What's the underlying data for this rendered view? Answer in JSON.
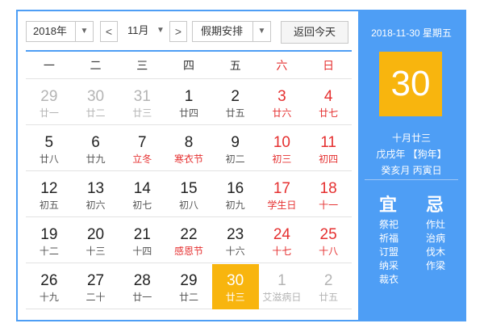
{
  "toolbar": {
    "year_select": "2018年",
    "prev_month": "<",
    "month_select": "11月",
    "next_month": ">",
    "holiday_select": "假期安排",
    "today_button": "返回今天"
  },
  "weekdays": [
    "一",
    "二",
    "三",
    "四",
    "五",
    "六",
    "日"
  ],
  "weeks": [
    [
      {
        "day": "29",
        "lunar": "廿一",
        "other": true
      },
      {
        "day": "30",
        "lunar": "廿二",
        "other": true
      },
      {
        "day": "31",
        "lunar": "廿三",
        "other": true
      },
      {
        "day": "1",
        "lunar": "廿四"
      },
      {
        "day": "2",
        "lunar": "廿五"
      },
      {
        "day": "3",
        "lunar": "廿六",
        "weekend": true
      },
      {
        "day": "4",
        "lunar": "廿七",
        "weekend": true
      }
    ],
    [
      {
        "day": "5",
        "lunar": "廿八"
      },
      {
        "day": "6",
        "lunar": "廿九"
      },
      {
        "day": "7",
        "lunar": "立冬",
        "festival": true
      },
      {
        "day": "8",
        "lunar": "寒衣节",
        "festival": true
      },
      {
        "day": "9",
        "lunar": "初二"
      },
      {
        "day": "10",
        "lunar": "初三",
        "weekend": true
      },
      {
        "day": "11",
        "lunar": "初四",
        "weekend": true
      }
    ],
    [
      {
        "day": "12",
        "lunar": "初五"
      },
      {
        "day": "13",
        "lunar": "初六"
      },
      {
        "day": "14",
        "lunar": "初七"
      },
      {
        "day": "15",
        "lunar": "初八"
      },
      {
        "day": "16",
        "lunar": "初九"
      },
      {
        "day": "17",
        "lunar": "学生日",
        "weekend": true
      },
      {
        "day": "18",
        "lunar": "十一",
        "weekend": true
      }
    ],
    [
      {
        "day": "19",
        "lunar": "十二"
      },
      {
        "day": "20",
        "lunar": "十三"
      },
      {
        "day": "21",
        "lunar": "十四"
      },
      {
        "day": "22",
        "lunar": "感恩节",
        "festival": true
      },
      {
        "day": "23",
        "lunar": "十六"
      },
      {
        "day": "24",
        "lunar": "十七",
        "weekend": true
      },
      {
        "day": "25",
        "lunar": "十八",
        "weekend": true
      }
    ],
    [
      {
        "day": "26",
        "lunar": "十九"
      },
      {
        "day": "27",
        "lunar": "二十"
      },
      {
        "day": "28",
        "lunar": "廿一"
      },
      {
        "day": "29",
        "lunar": "廿二"
      },
      {
        "day": "30",
        "lunar": "廿三",
        "selected": true
      },
      {
        "day": "1",
        "lunar": "艾滋病日",
        "other": true
      },
      {
        "day": "2",
        "lunar": "廿五",
        "other": true
      }
    ]
  ],
  "panel": {
    "date": "2018-11-30 星期五",
    "big_day": "30",
    "lunar_date": "十月廿三",
    "year_gz": "戊戌年 【狗年】",
    "month_day_gz": "癸亥月 丙寅日",
    "yi_label": "宜",
    "ji_label": "忌",
    "yi": [
      "祭祀",
      "祈福",
      "订盟",
      "纳采",
      "裁衣"
    ],
    "ji": [
      "作灶",
      "治病",
      "伐木",
      "作梁"
    ]
  },
  "colors": {
    "accent_blue": "#4e9ef5",
    "selected_orange": "#f8b50e",
    "weekend_red": "#e53030"
  }
}
